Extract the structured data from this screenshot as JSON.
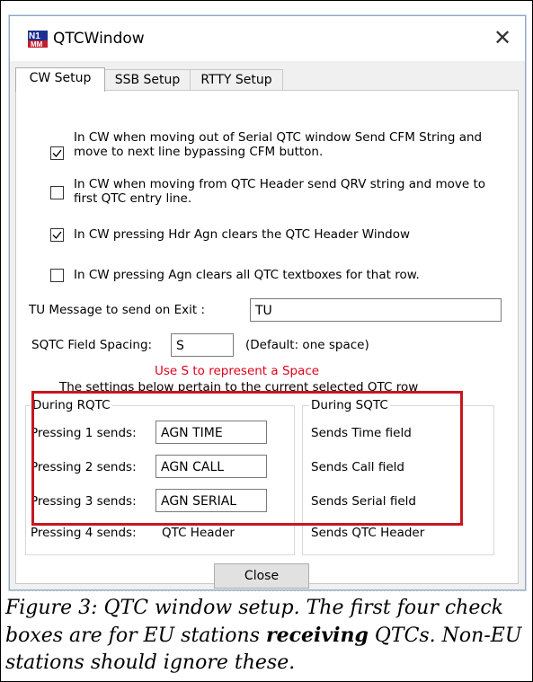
{
  "window": {
    "title": "QTCWindow",
    "close_glyph": "✕"
  },
  "tabs": [
    {
      "label": "CW Setup",
      "active": true
    },
    {
      "label": "SSB Setup",
      "active": false
    },
    {
      "label": "RTTY Setup",
      "active": false
    }
  ],
  "checkboxes": [
    {
      "checked": true,
      "text": "In CW when moving out of Serial QTC window Send CFM String and move to next line bypassing CFM button."
    },
    {
      "checked": false,
      "text": "In CW when moving from QTC Header send QRV string and move to first QTC entry line."
    },
    {
      "checked": true,
      "text": "In CW pressing Hdr Agn clears the QTC Header Window"
    },
    {
      "checked": false,
      "text": "In CW pressing Agn clears all QTC textboxes for that row."
    }
  ],
  "tu_message": {
    "label": "TU Message to send on Exit :",
    "value": "TU"
  },
  "sqtc_spacing": {
    "label": "SQTC Field Spacing:",
    "value": "S",
    "default_note": "(Default: one space)"
  },
  "hint": {
    "text": "Use S to represent a Space",
    "color": "#e0001a"
  },
  "info_text": "The settings below pertain to the current selected QTC row",
  "rqtc_group": {
    "title": "During RQTC",
    "rows": [
      {
        "label": "Pressing 1 sends:",
        "value": "AGN TIME"
      },
      {
        "label": "Pressing 2 sends:",
        "value": "AGN CALL"
      },
      {
        "label": "Pressing 3 sends:",
        "value": "AGN SERIAL"
      }
    ],
    "row4": {
      "label": "Pressing 4 sends:",
      "value": "QTC Header"
    }
  },
  "sqtc_group": {
    "title": "During SQTC",
    "rows": [
      "Sends Time field",
      "Sends Call field",
      "Sends Serial field",
      "Sends QTC Header"
    ]
  },
  "close_button": "Close",
  "caption": {
    "part1": "Figure 3: QTC window setup. The first four check boxes are for EU stations ",
    "bold": "receiving",
    "part2": " QTCs. Non-EU stations should ignore these."
  },
  "colors": {
    "highlight_box": "#c5181f",
    "hint": "#e0001a",
    "window_border": "#8aa9c9"
  },
  "icons": {
    "app": "n1mm-logo-icon",
    "close": "close-icon",
    "check": "check-icon"
  }
}
